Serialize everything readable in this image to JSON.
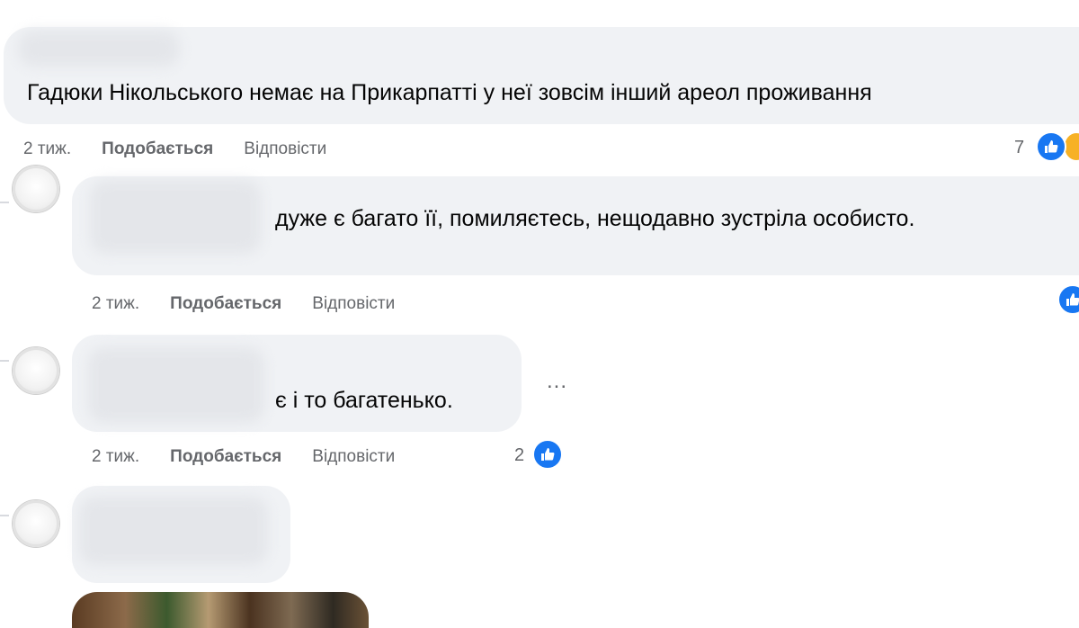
{
  "comments": [
    {
      "text": "Гадюки Нікольського немає на Прикарпатті у неї зовсім інший ареол проживання",
      "time": "2 тиж.",
      "like_label": "Подобається",
      "reply_label": "Відповісти",
      "reaction_count": "7",
      "reactions": [
        "like-icon",
        "haha-icon"
      ]
    },
    {
      "text": "дуже є багато її, помиляєтесь, нещодавно зустріла особисто.",
      "time": "2 тиж.",
      "like_label": "Подобається",
      "reply_label": "Відповісти",
      "reactions": [
        "like-icon"
      ]
    },
    {
      "text": "є і то багатенько.",
      "time": "2 тиж.",
      "like_label": "Подобається",
      "reply_label": "Відповісти",
      "reaction_count": "2",
      "reactions": [
        "like-icon"
      ],
      "more_label": "..."
    },
    {
      "text": ""
    }
  ],
  "colors": {
    "bubble": "#f0f2f5",
    "meta_text": "#65676b",
    "like_blue": "#1877f2"
  }
}
